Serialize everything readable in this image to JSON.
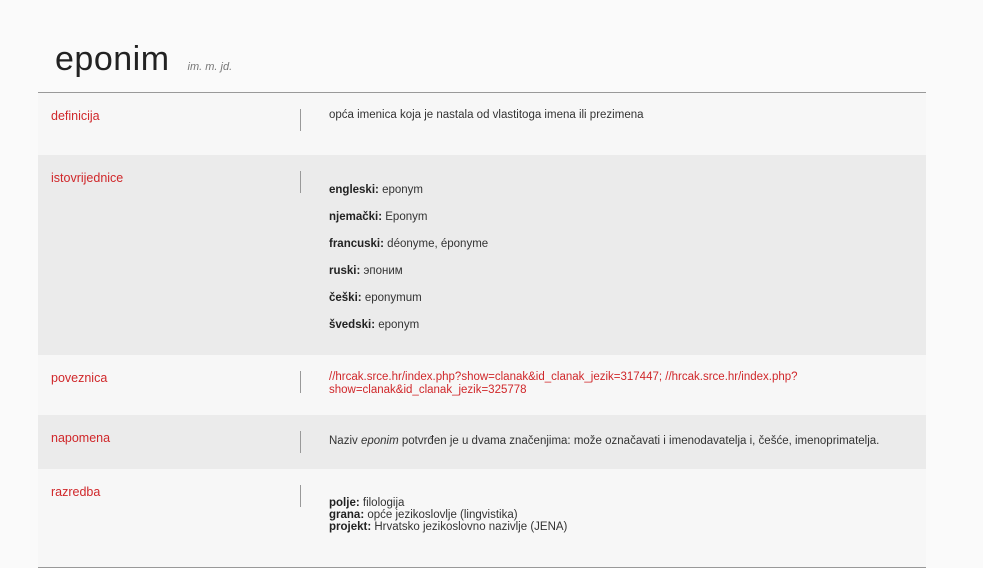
{
  "entry": {
    "term": "eponim",
    "grammar": "im. m. jd."
  },
  "rows": {
    "definicija": {
      "label": "definicija",
      "text": "opća imenica koja je nastala od vlastitoga imena ili prezimena"
    },
    "istovrijednice": {
      "label": "istovrijednice",
      "items": [
        {
          "lang": "engleski:",
          "value": "eponym"
        },
        {
          "lang": "njemački:",
          "value": "Eponym"
        },
        {
          "lang": "francuski:",
          "value": "déonyme, éponyme"
        },
        {
          "lang": "ruski:",
          "value": "эпоним"
        },
        {
          "lang": "češki:",
          "value": "eponymum"
        },
        {
          "lang": "švedski:",
          "value": "eponym"
        }
      ]
    },
    "poveznica": {
      "label": "poveznica",
      "link": "//hrcak.srce.hr/index.php?show=clanak&id_clanak_jezik=317447; //hrcak.srce.hr/index.php?show=clanak&id_clanak_jezik=325778"
    },
    "napomena": {
      "label": "napomena",
      "pre": "Naziv ",
      "em": "eponim",
      "post": " potvrđen je u dvama značenjima: može označavati i imenodavatelja i, češće, imenoprimatelja."
    },
    "razredba": {
      "label": "razredba",
      "items": [
        {
          "key": "polje:",
          "value": "filologija"
        },
        {
          "key": "grana:",
          "value": "opće jezikoslovlje (lingvistika)"
        },
        {
          "key": "projekt:",
          "value": "Hrvatsko jezikoslovno nazivlje (JENA)"
        }
      ]
    }
  }
}
